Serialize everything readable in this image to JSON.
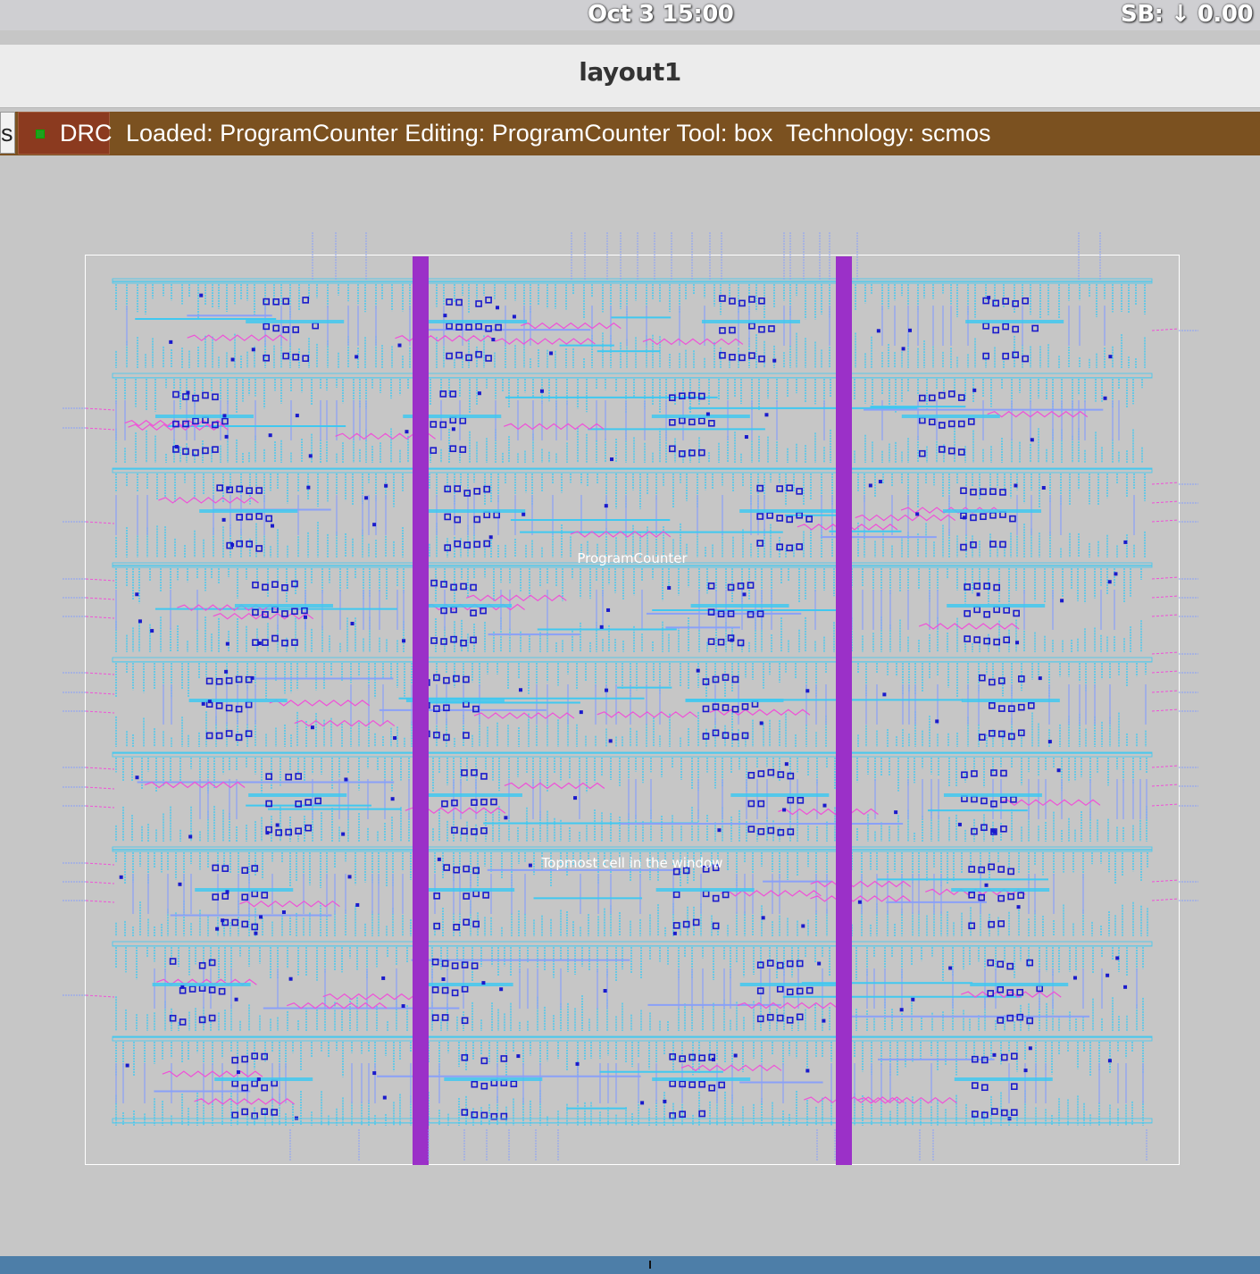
{
  "topbar": {
    "clock": "Oct 3  15:00",
    "status": "SB: ↓ 0.00"
  },
  "window": {
    "title": "layout1"
  },
  "menustrip": {
    "prev_tab_label": "s",
    "drc_label": "DRC",
    "status_text": "Loaded: ProgramCounter Editing: ProgramCounter Tool: box  Technology: scmos"
  },
  "layout": {
    "cell_name": "ProgramCounter",
    "topmost_label": "Topmost cell in the window",
    "colors": {
      "background": "#c6c6c6",
      "metal1": "#40c8f0",
      "metal2": "#8aa0f8",
      "poly": "#f050d8",
      "contact": "#1a1acc",
      "power_rail": "#9b30c8",
      "bbox": "#ffffff"
    }
  },
  "colors": {
    "menustrip": "#7b5120",
    "drc_button": "#8b3a1f",
    "bottombar": "#4d7ea8"
  }
}
